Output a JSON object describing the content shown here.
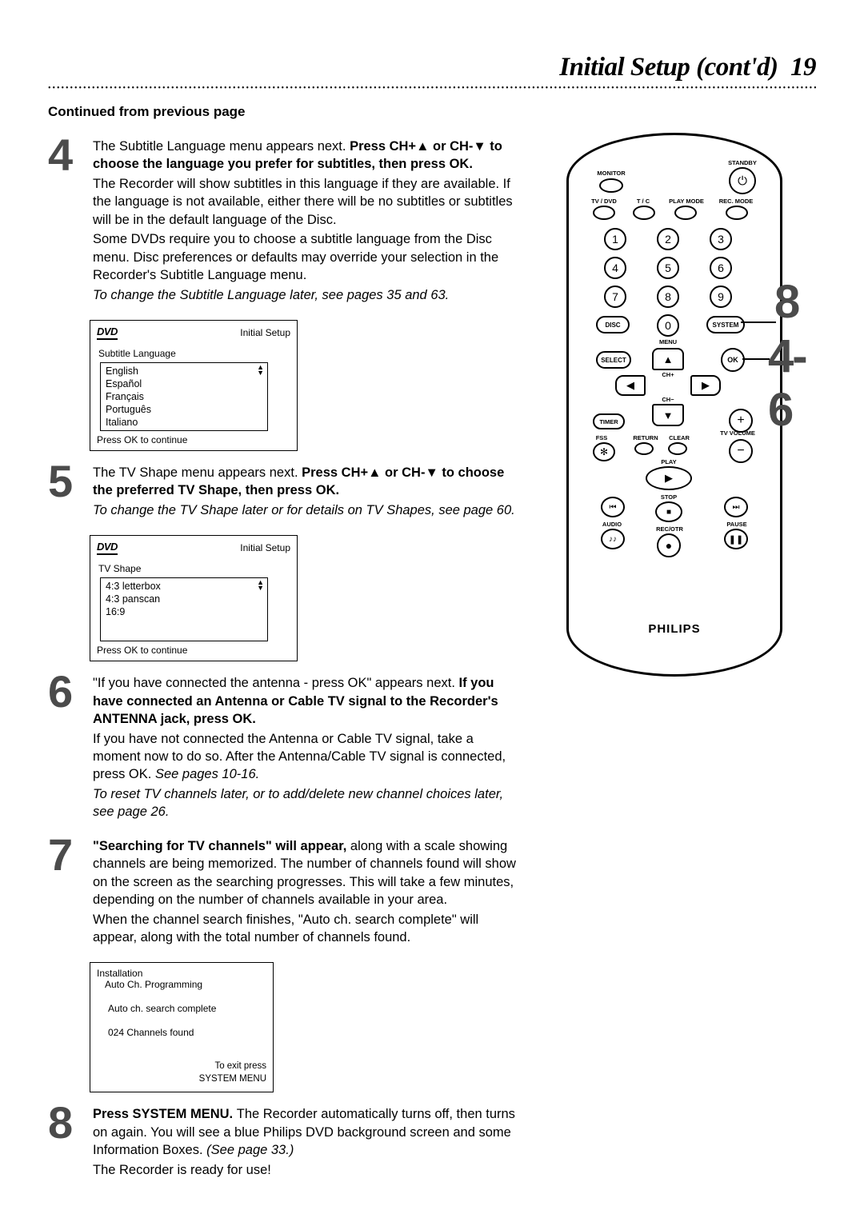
{
  "header": {
    "title": "Initial Setup (cont'd)",
    "page_number": "19"
  },
  "continued": "Continued from previous page",
  "steps": {
    "s4": {
      "num": "4",
      "line1a": "The Subtitle Language menu appears next. ",
      "line1b": "Press CH+▲ or CH-▼ to choose the language you prefer for subtitles, then press OK.",
      "line2": "The Recorder will show subtitles in this language if they are available. If the language is not available, either there will be no subtitles or subtitles will be in the default language of the Disc.",
      "line3": "Some DVDs require you to choose a subtitle language from the Disc menu. Disc preferences or defaults may override your selection in the Recorder's Subtitle Language menu.",
      "line4_italic": "To change the Subtitle Language later, see pages 35 and 63."
    },
    "s5": {
      "num": "5",
      "line1a": "The TV Shape menu appears next. ",
      "line1b": "Press CH+▲ or CH-▼ to choose the preferred TV Shape, then press OK.",
      "line2_italic": "To change the TV Shape later or for details on TV Shapes, see page 60."
    },
    "s6": {
      "num": "6",
      "line1a": "\"If you have connected the antenna - press OK\" appears next. ",
      "line1b": "If you have connected an Antenna or Cable TV signal to the Recorder's ANTENNA jack, press OK.",
      "line2a": "If you have not connected the Antenna or Cable TV signal, take a moment now to do so. After the Antenna/Cable TV signal is connected, press OK. ",
      "line2b_italic": "See pages 10-16.",
      "line3_italic": "To reset TV channels later, or to add/delete new channel choices later, see page 26."
    },
    "s7": {
      "num": "7",
      "line1a": "\"Searching for TV channels\" will appear, ",
      "line1b": "along with a scale showing channels are being memorized. The number of channels found will show on the screen as the searching progresses. This will take a few minutes, depending on the number of channels available in your area.",
      "line2": "When the channel search finishes, \"Auto ch. search complete\" will appear, along with the total number of channels found."
    },
    "s8": {
      "num": "8",
      "line1a": "Press SYSTEM MENU. ",
      "line1b": "The Recorder automatically turns off, then turns on again. You will see a blue Philips DVD background screen and some Information Boxes. ",
      "line1c_italic": "(See page 33.)",
      "line2": "The Recorder is ready for use!"
    }
  },
  "osd1": {
    "logo": "DVD",
    "header_right": "Initial Setup",
    "menu_label": "Subtitle Language",
    "items": [
      "English",
      "Español",
      "Français",
      "Português",
      "Italiano"
    ],
    "footer": "Press OK to continue"
  },
  "osd2": {
    "logo": "DVD",
    "header_right": "Initial Setup",
    "menu_label": "TV Shape",
    "items": [
      "4:3 letterbox",
      "4:3 panscan",
      "16:9"
    ],
    "footer": "Press OK to continue"
  },
  "osd3": {
    "title": "Installation",
    "subtitle": "Auto Ch. Programming",
    "status": "Auto ch. search complete",
    "found": "024 Channels found",
    "footer1": "To exit press",
    "footer2": "SYSTEM MENU"
  },
  "remote": {
    "labels": {
      "standby": "STANDBY",
      "monitor": "MONITOR",
      "tvdvd": "TV / DVD",
      "tc": "T / C",
      "playmode": "PLAY MODE",
      "recmode": "REC. MODE",
      "disc": "DISC",
      "menu": "MENU",
      "system": "SYSTEM",
      "select": "SELECT",
      "ok": "OK",
      "chplus": "CH+",
      "chminus": "CH−",
      "timer": "TIMER",
      "fss": "FSS",
      "return": "RETURN",
      "clear": "CLEAR",
      "tvvolume": "TV VOLUME",
      "play": "PLAY",
      "stop": "STOP",
      "audio": "AUDIO",
      "pause": "PAUSE",
      "recotr": "REC/OTR"
    },
    "brand": "PHILIPS",
    "callout8": "8",
    "callout46": "4-6"
  }
}
